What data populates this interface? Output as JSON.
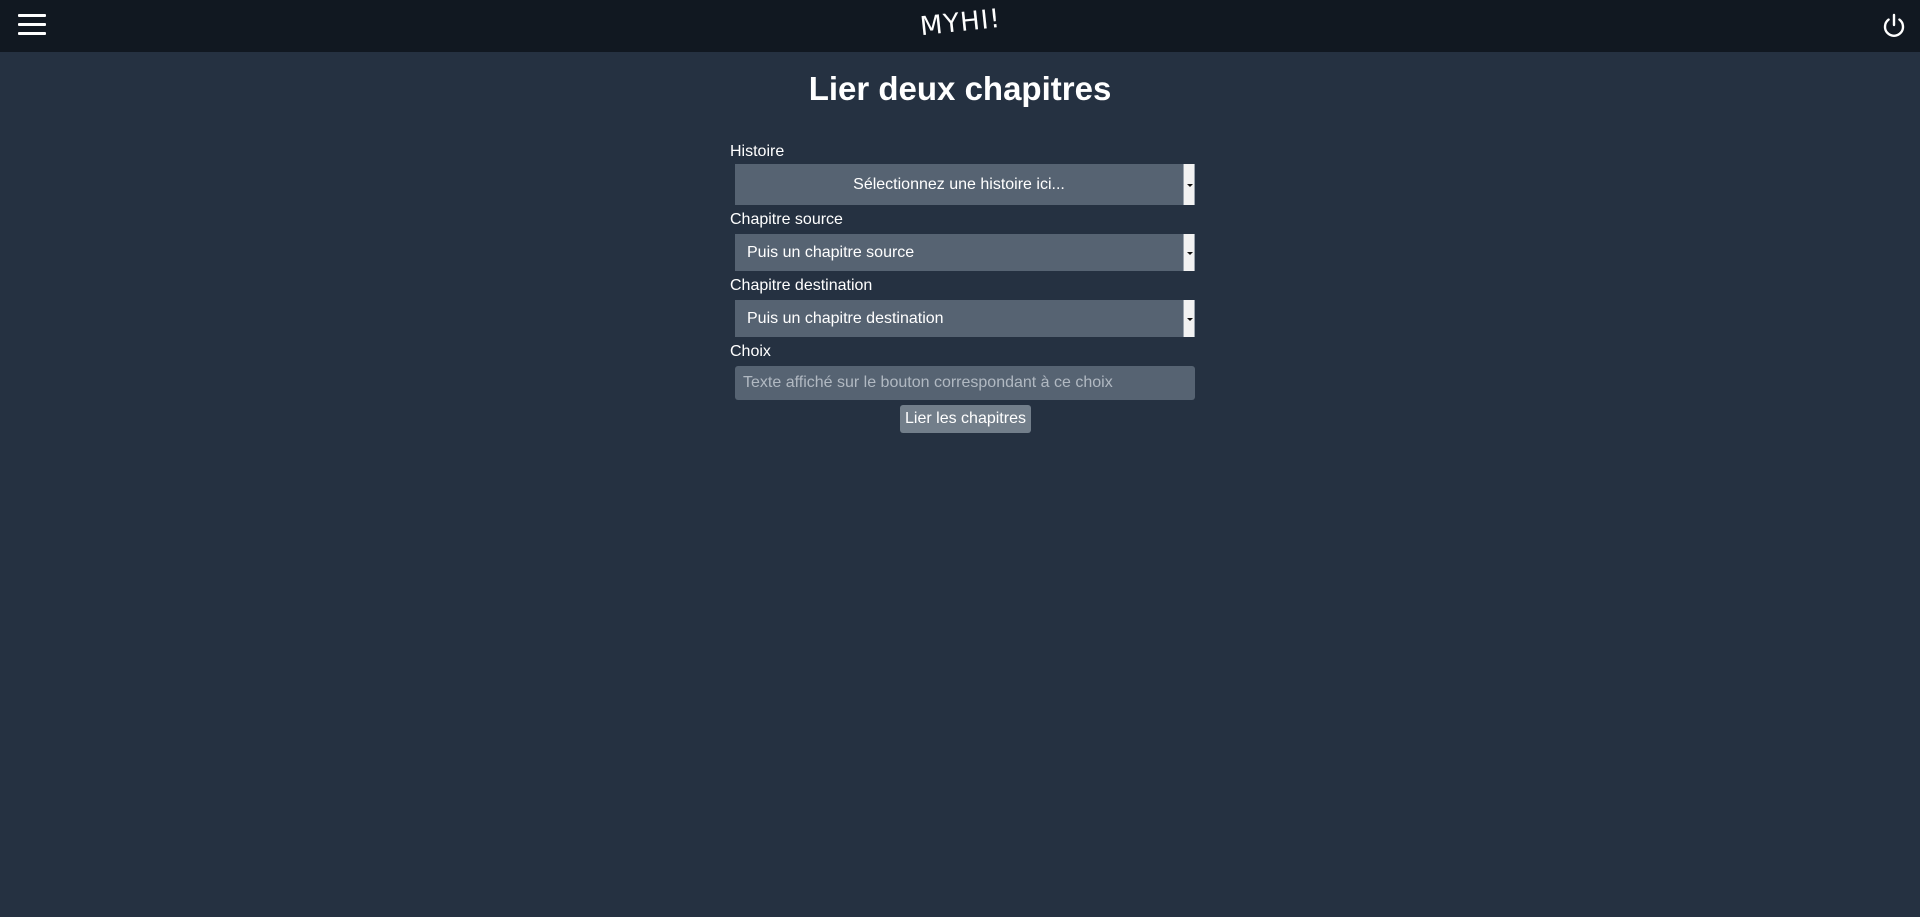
{
  "header": {
    "menu_icon": "hamburger-menu-icon",
    "logo_text": "MYHI!",
    "power_icon": "power-icon"
  },
  "page": {
    "title": "Lier deux chapitres"
  },
  "form": {
    "story": {
      "label": "Histoire",
      "selected": "Sélectionnez une histoire ici..."
    },
    "source_chapter": {
      "label": "Chapitre source",
      "selected": "Puis un chapitre source"
    },
    "destination_chapter": {
      "label": "Chapitre destination",
      "selected": "Puis un chapitre destination"
    },
    "choice": {
      "label": "Choix",
      "value": "",
      "placeholder": "Texte affiché sur le bouton correspondant à ce choix"
    },
    "submit_label": "Lier les chapitres"
  },
  "colors": {
    "page_background": "#253141",
    "topbar_background": "#111821",
    "field_background": "#566372",
    "button_background": "#727e8a"
  }
}
